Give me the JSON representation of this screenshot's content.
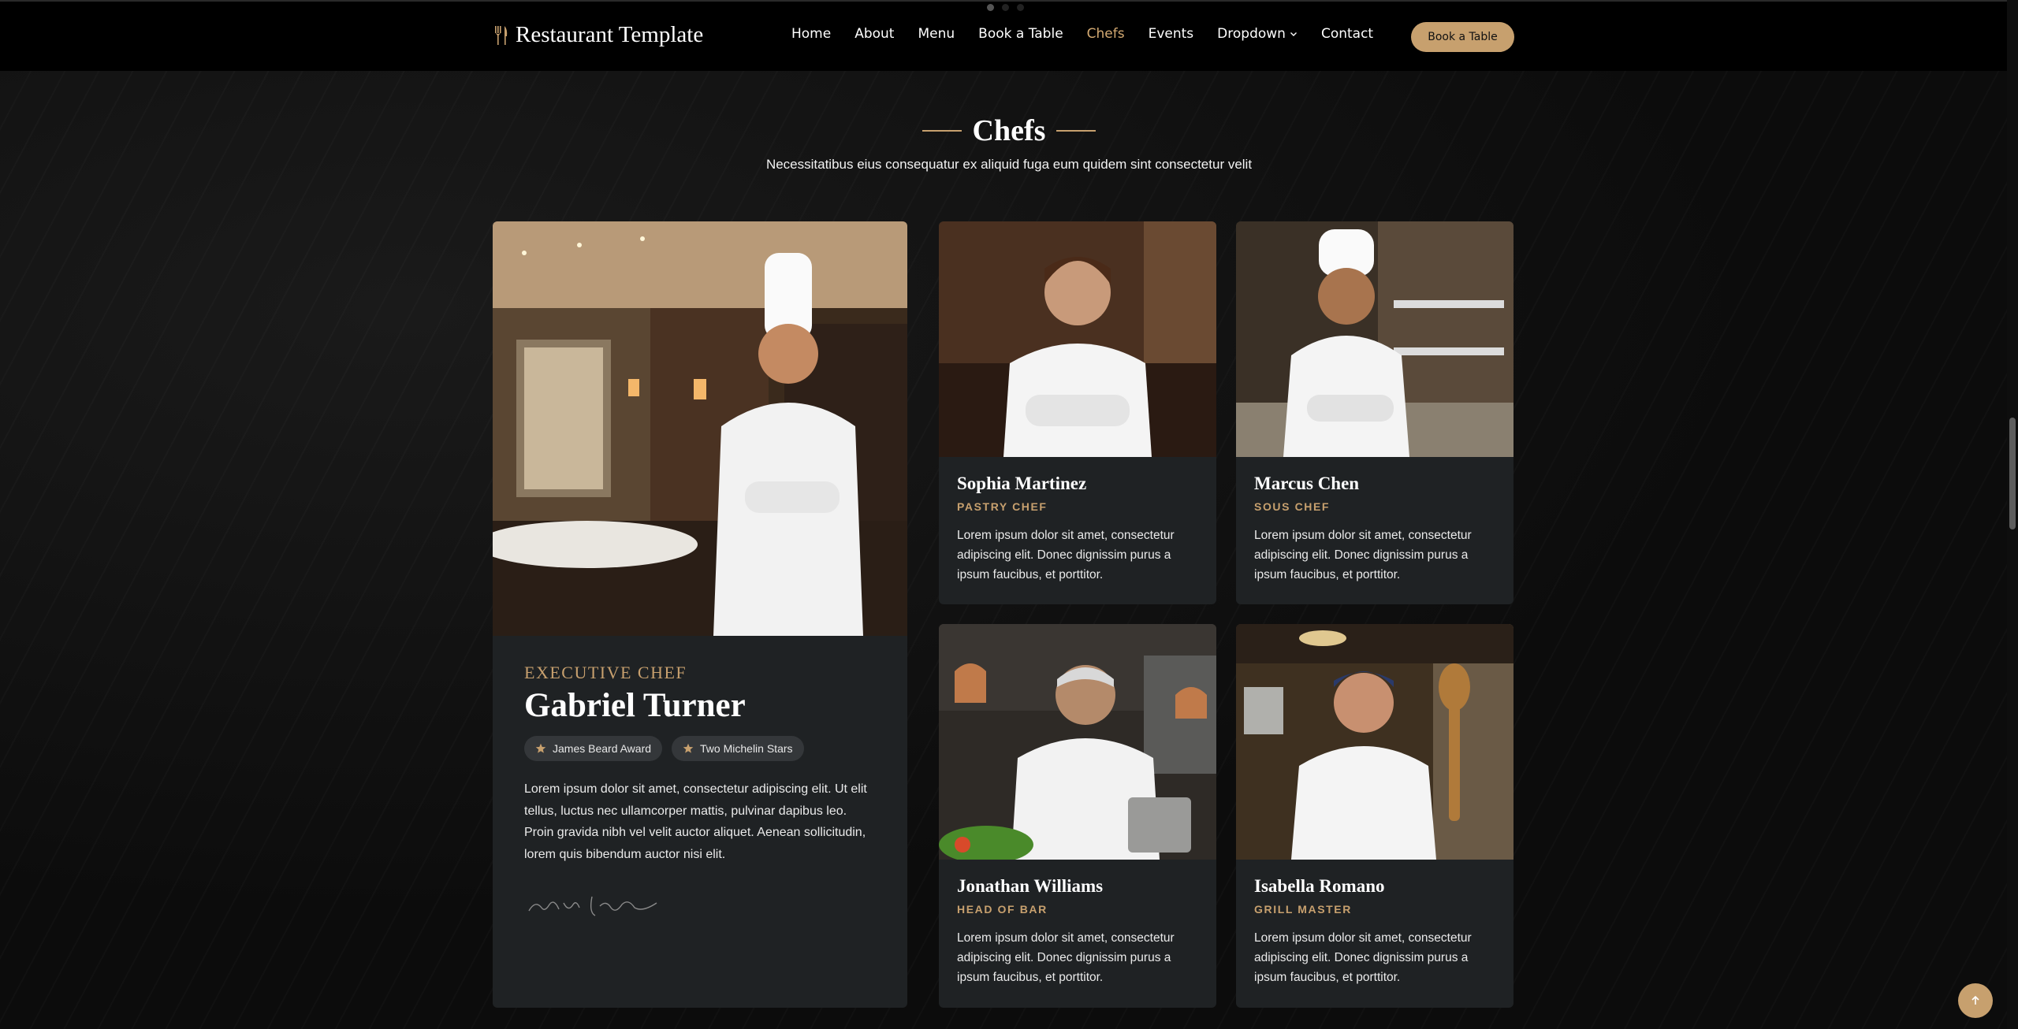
{
  "header": {
    "brand": "Restaurant Template",
    "brand_icon": "fork-knife-icon",
    "nav": [
      {
        "label": "Home",
        "active": false
      },
      {
        "label": "About",
        "active": false
      },
      {
        "label": "Menu",
        "active": false
      },
      {
        "label": "Book a Table",
        "active": false
      },
      {
        "label": "Chefs",
        "active": true
      },
      {
        "label": "Events",
        "active": false
      },
      {
        "label": "Dropdown",
        "active": false
      },
      {
        "label": "Contact",
        "active": false
      }
    ],
    "cta": "Book a Table"
  },
  "section": {
    "title": "Chefs",
    "subtitle": "Necessitatibus eius consequatur ex aliquid fuga eum quidem sint consectetur velit"
  },
  "executive": {
    "role": "EXECUTIVE CHEF",
    "name": "Gabriel Turner",
    "badges": [
      "James Beard Award",
      "Two Michelin Stars"
    ],
    "description": "Lorem ipsum dolor sit amet, consectetur adipiscing elit. Ut elit tellus, luctus nec ullamcorper mattis, pulvinar dapibus leo. Proin gravida nibh vel velit auctor aliquet. Aenean sollicitudin, lorem quis bibendum auctor nisi elit.",
    "signature": "Chef Johnson"
  },
  "chefs": [
    {
      "name": "Sophia Martinez",
      "role": "PASTRY CHEF",
      "description": "Lorem ipsum dolor sit amet, consectetur adipiscing elit. Donec dignissim purus a ipsum faucibus, et porttitor."
    },
    {
      "name": "Marcus Chen",
      "role": "SOUS CHEF",
      "description": "Lorem ipsum dolor sit amet, consectetur adipiscing elit. Donec dignissim purus a ipsum faucibus, et porttitor."
    },
    {
      "name": "Jonathan Williams",
      "role": "HEAD OF BAR",
      "description": "Lorem ipsum dolor sit amet, consectetur adipiscing elit. Donec dignissim purus a ipsum faucibus, et porttitor."
    },
    {
      "name": "Isabella Romano",
      "role": "GRILL MASTER",
      "description": "Lorem ipsum dolor sit amet, consectetur adipiscing elit. Donec dignissim purus a ipsum faucibus, et porttitor."
    }
  ],
  "colors": {
    "accent": "#c7a06e",
    "card": "#1f2224",
    "background": "#0b0b0b"
  },
  "icons": {
    "badge": "star-icon",
    "to_top": "arrow-up-icon",
    "dropdown": "chevron-down-icon"
  }
}
